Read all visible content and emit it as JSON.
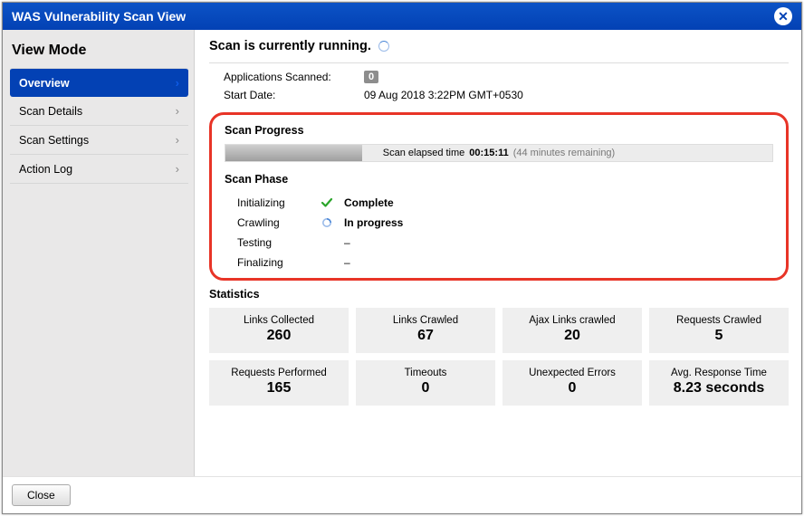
{
  "window": {
    "title": "WAS Vulnerability Scan View"
  },
  "sidebar": {
    "heading": "View Mode",
    "items": [
      {
        "label": "Overview"
      },
      {
        "label": "Scan Details"
      },
      {
        "label": "Scan Settings"
      },
      {
        "label": "Action Log"
      }
    ]
  },
  "main": {
    "heading": "Scan is currently running.",
    "apps_scanned_label": "Applications Scanned:",
    "apps_scanned_value": "0",
    "start_date_label": "Start Date:",
    "start_date_value": "09 Aug 2018 3:22PM GMT+0530"
  },
  "progress": {
    "title": "Scan Progress",
    "elapsed_prefix": "Scan elapsed time",
    "elapsed_value": "00:15:11",
    "remaining_text": "(44 minutes remaining)",
    "percent": 25
  },
  "phases": {
    "title": "Scan Phase",
    "rows": [
      {
        "name": "Initializing",
        "status": "Complete",
        "icon": "check"
      },
      {
        "name": "Crawling",
        "status": "In progress",
        "icon": "spin"
      },
      {
        "name": "Testing",
        "status": "–",
        "icon": "none"
      },
      {
        "name": "Finalizing",
        "status": "–",
        "icon": "none"
      }
    ]
  },
  "stats": {
    "title": "Statistics",
    "boxes": [
      {
        "label": "Links Collected",
        "value": "260"
      },
      {
        "label": "Links Crawled",
        "value": "67"
      },
      {
        "label": "Ajax Links crawled",
        "value": "20"
      },
      {
        "label": "Requests Crawled",
        "value": "5"
      },
      {
        "label": "Requests Performed",
        "value": "165"
      },
      {
        "label": "Timeouts",
        "value": "0"
      },
      {
        "label": "Unexpected Errors",
        "value": "0"
      },
      {
        "label": "Avg. Response Time",
        "value": "8.23 seconds"
      }
    ]
  },
  "footer": {
    "close_label": "Close"
  }
}
